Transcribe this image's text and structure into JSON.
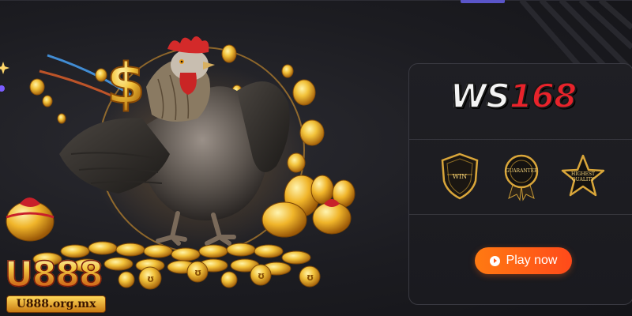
{
  "hero": {
    "logo": {
      "word": "U888",
      "domain": "U888.org.mx"
    }
  },
  "card": {
    "brand": {
      "part_a": "WS",
      "part_b": "168"
    },
    "badges": [
      {
        "name": "win-badge",
        "label": "WIN"
      },
      {
        "name": "guarantee-medal-badge",
        "label": "GUARANTEE"
      },
      {
        "name": "highest-quality-star-badge",
        "label": "HIGHEST QUALITY"
      }
    ],
    "play_button": {
      "label": "Play now",
      "icon": "play-circle-icon"
    }
  },
  "colors": {
    "background": "#1c1c21",
    "accent_orange": "#ff5a18",
    "gold": "#f4c842",
    "brand_red": "#e8232b",
    "tab_indicator": "#5a55c9"
  }
}
